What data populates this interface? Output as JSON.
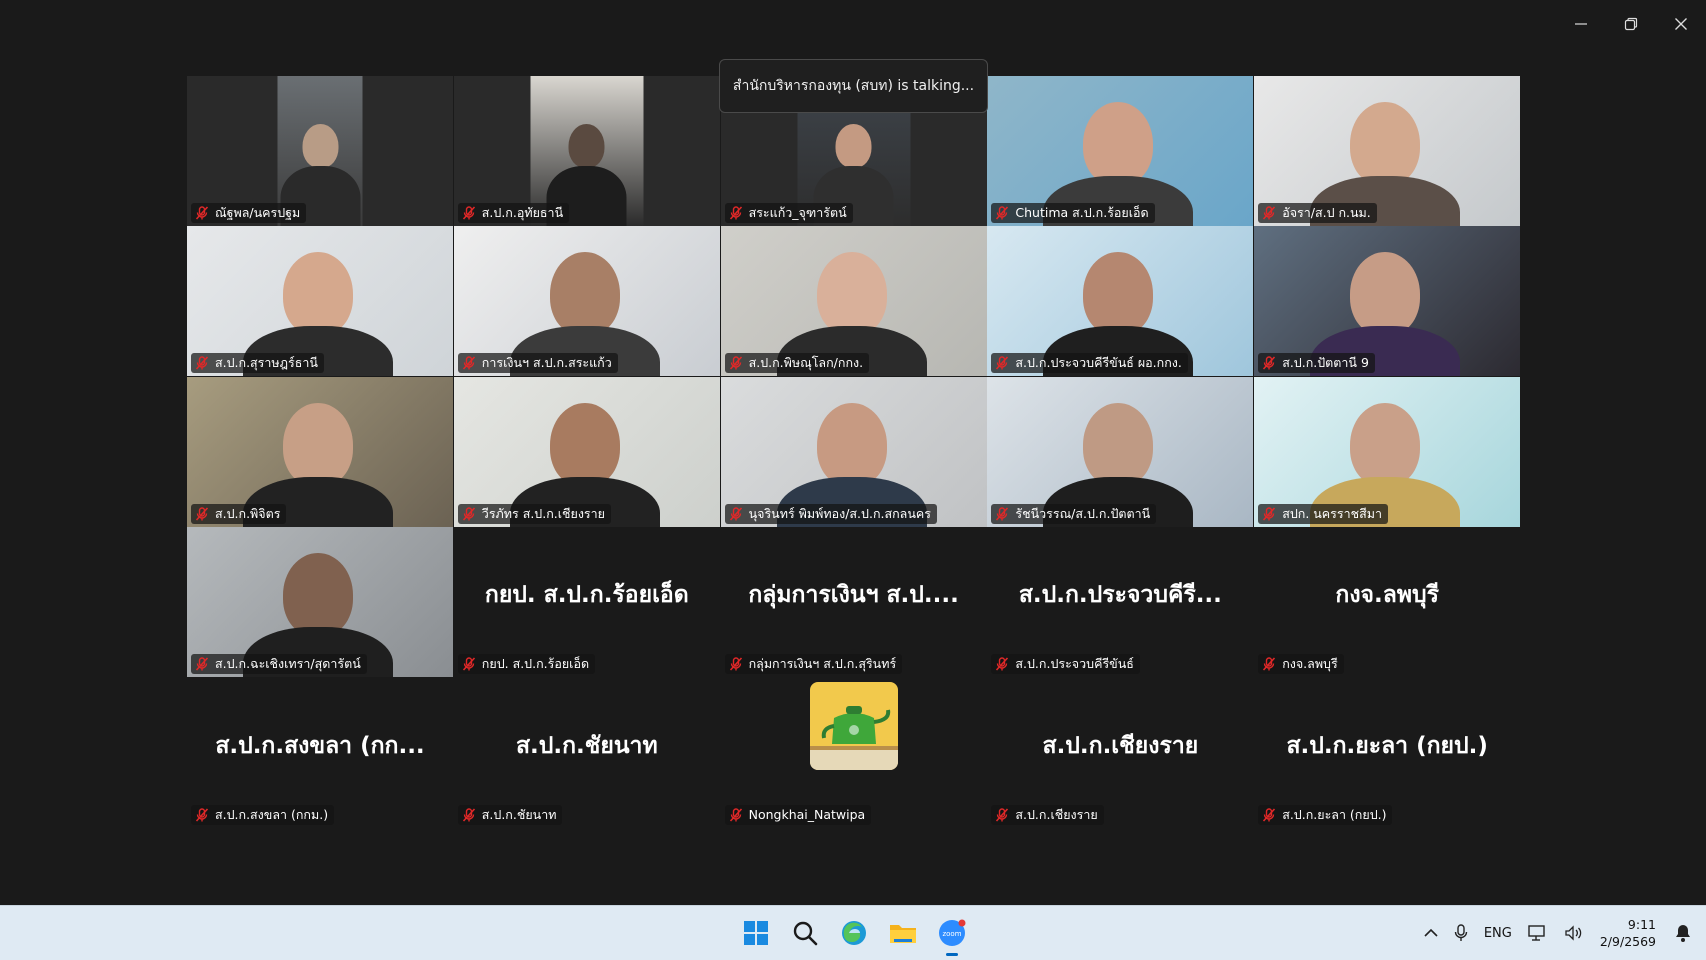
{
  "toast": {
    "text": "สำนักบริหารกองทุน (สบท) is talking..."
  },
  "window": {
    "minimize": "minimize-icon",
    "restore": "restore-icon",
    "close": "close-icon"
  },
  "tiles": [
    {
      "name": "ณัฐพล/นครปฐม",
      "kind": "video"
    },
    {
      "name": "ส.ป.ก.อุทัยธานี",
      "kind": "video"
    },
    {
      "name": "สระแก้ว_จุฑารัตน์",
      "kind": "video"
    },
    {
      "name": "Chutima ส.ป.ก.ร้อยเอ็ด",
      "kind": "video"
    },
    {
      "name": "อัจรา/ส.ป ก.นม.",
      "kind": "video"
    },
    {
      "name": "ส.ป.ก.สุราษฎร์ธานี",
      "kind": "video"
    },
    {
      "name": "การเงินฯ ส.ป.ก.สระแก้ว",
      "kind": "video"
    },
    {
      "name": "ส.ป.ก.พิษณุโลก/กกง.",
      "kind": "video"
    },
    {
      "name": "ส.ป.ก.ประจวบคีรีขันธ์ ผอ.กกง.",
      "kind": "video"
    },
    {
      "name": "ส.ป.ก.ปัตตานี 9",
      "kind": "video"
    },
    {
      "name": "ส.ป.ก.พิจิตร",
      "kind": "video"
    },
    {
      "name": "วีรภัทร ส.ป.ก.เชียงราย",
      "kind": "video"
    },
    {
      "name": "นุจรินทร์ พิมพ์ทอง/ส.ป.ก.สกลนคร",
      "kind": "video"
    },
    {
      "name": "รัชนีวรรณ/ส.ป.ก.ปัตตานี",
      "kind": "video"
    },
    {
      "name": "สปก. นครราชสีมา",
      "kind": "video"
    },
    {
      "name": "ส.ป.ก.ฉะเชิงเทรา/สุดารัตน์",
      "kind": "video"
    },
    {
      "name": "กยป. ส.ป.ก.ร้อยเอ็ด",
      "kind": "name",
      "display": "กยป. ส.ป.ก.ร้อยเอ็ด"
    },
    {
      "name": "กลุ่มการเงินฯ ส.ป.ก.สุรินทร์",
      "kind": "name",
      "display": "กลุ่มการเงินฯ ส.ป...."
    },
    {
      "name": "ส.ป.ก.ประจวบคีรีขันธ์",
      "kind": "name",
      "display": "ส.ป.ก.ประจวบคีรี..."
    },
    {
      "name": "กงจ.ลพบุรี",
      "kind": "name",
      "display": "กงจ.ลพบุรี"
    },
    {
      "name": "ส.ป.ก.สงขลา (กกม.)",
      "kind": "name",
      "display": "ส.ป.ก.สงขลา (กก..."
    },
    {
      "name": "ส.ป.ก.ชัยนาท",
      "kind": "name",
      "display": "ส.ป.ก.ชัยนาท"
    },
    {
      "name": "Nongkhai_Natwipa",
      "kind": "avatar",
      "icon": "kettle-icon"
    },
    {
      "name": "ส.ป.ก.เชียงราย",
      "kind": "name",
      "display": "ส.ป.ก.เชียงราย"
    },
    {
      "name": "ส.ป.ก.ยะลา (กยป.)",
      "kind": "name",
      "display": "ส.ป.ก.ยะลา (กยป.)"
    }
  ],
  "taskbar": {
    "apps": [
      "windows-start-icon",
      "search-icon",
      "edge-browser-icon",
      "file-explorer-icon",
      "zoom-app-icon"
    ],
    "tray": {
      "language": "ENG",
      "time": "9:11",
      "date": "2/9/2569"
    }
  },
  "colors": {
    "accent": "#0067c0",
    "mic_off": "#e02828",
    "taskbar_bg": "#dfeaf3"
  }
}
